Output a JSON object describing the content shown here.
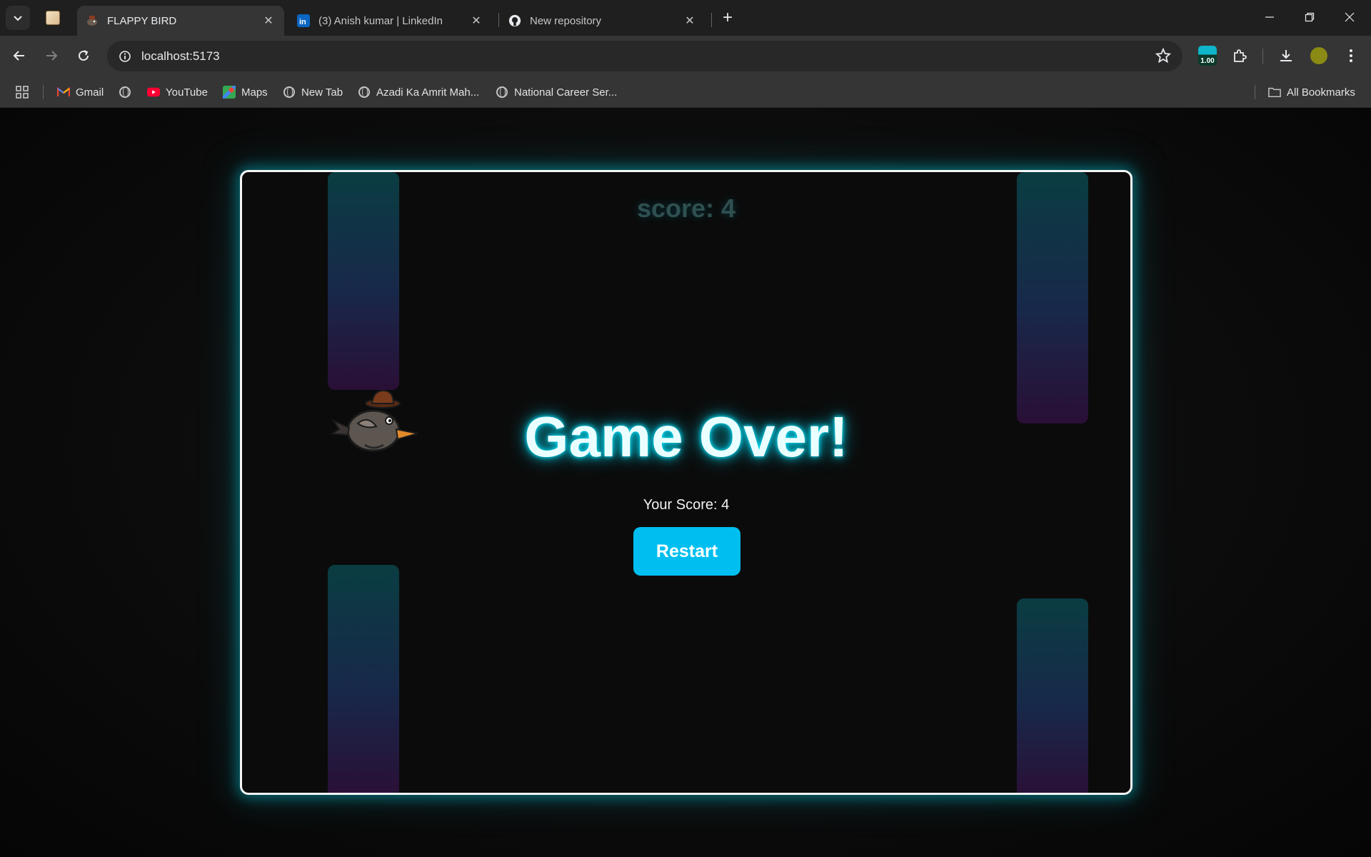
{
  "browser": {
    "tabs": [
      {
        "title": "FLAPPY BIRD",
        "favicon": "bird-favicon",
        "active": true
      },
      {
        "title": "(3) Anish kumar | LinkedIn",
        "favicon": "linkedin-icon",
        "active": false
      },
      {
        "title": "New repository",
        "favicon": "github-icon",
        "active": false
      }
    ],
    "url": "localhost:5173",
    "extension_badge": "1.00",
    "bookmarks": [
      {
        "label": "Gmail",
        "icon": "gmail-icon"
      },
      {
        "label": "",
        "icon": "globe-icon"
      },
      {
        "label": "YouTube",
        "icon": "youtube-icon"
      },
      {
        "label": "Maps",
        "icon": "maps-icon"
      },
      {
        "label": "New Tab",
        "icon": "globe-icon"
      },
      {
        "label": "Azadi Ka Amrit Mah...",
        "icon": "globe-icon"
      },
      {
        "label": "National Career Ser...",
        "icon": "globe-icon"
      }
    ],
    "all_bookmarks": "All Bookmarks"
  },
  "game": {
    "score_text": "score: 4",
    "game_over_title": "Game Over!",
    "final_score_text": "Your Score: 4",
    "restart_label": "Restart"
  },
  "colors": {
    "accent": "#00bff0",
    "glow": "#00e5ff",
    "pipe_top": "#0a3d42",
    "pipe_bottom": "#2a0f36",
    "page_bg": "#0a0a0a"
  }
}
